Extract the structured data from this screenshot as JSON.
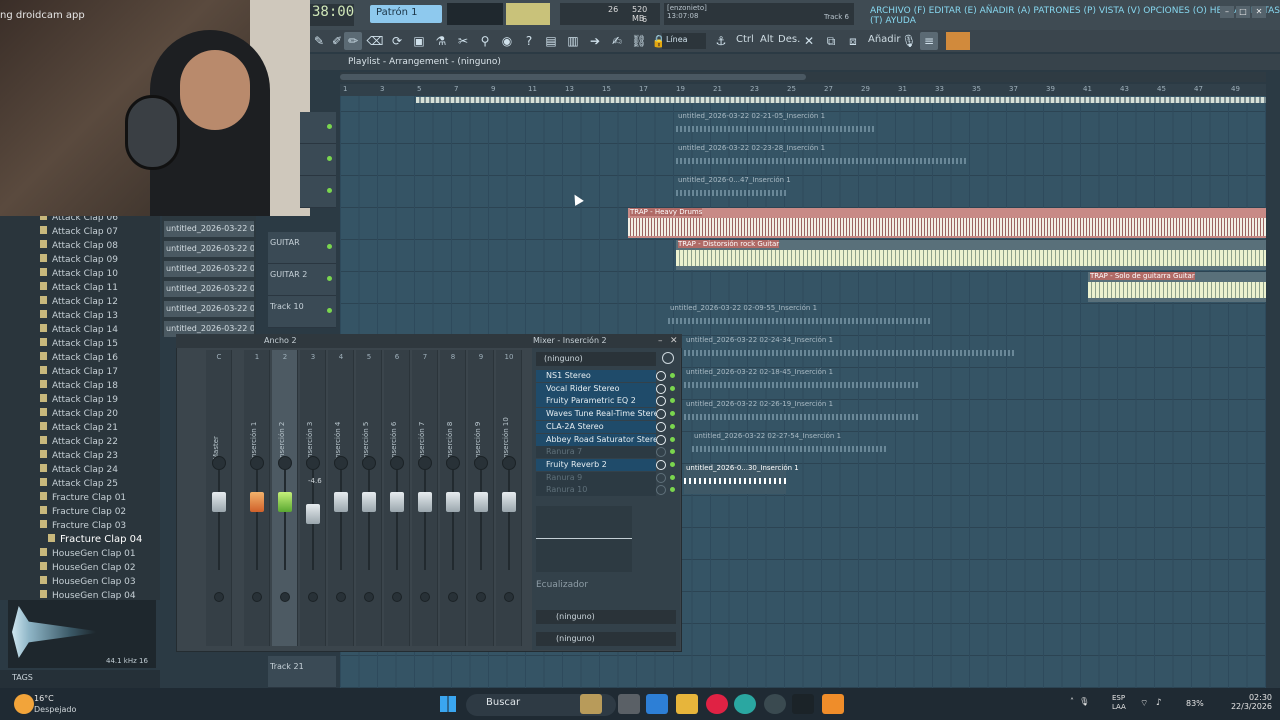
{
  "webcam": {
    "title": "ng droidcam app"
  },
  "topbar": {
    "clock": "38:00",
    "pattern": "Patrón 1",
    "cpu_num": "26",
    "memory": "520 MB",
    "polyphony": "6",
    "hint_title": "[enzonieto]",
    "hint_time": "13:07:08",
    "hint_track": "Track 6",
    "menu": "ARCHIVO (F) EDITAR (E) AÑADIR (A) PATRONES (P) VISTA (V) OPCIONES (O) HERRAMIENTAS (T) AYUDA"
  },
  "toolbar": {
    "line_mode": "Línea",
    "ctrl": "Ctrl",
    "alt": "Alt",
    "des": "Des.",
    "add": "Añadir"
  },
  "playlist": {
    "title": "Playlist - Arrangement - (ninguno)",
    "ruler": [
      "1",
      "3",
      "5",
      "7",
      "9",
      "11",
      "13",
      "15",
      "17",
      "19",
      "21",
      "23",
      "25",
      "27",
      "29",
      "31",
      "33",
      "35",
      "37",
      "39",
      "41",
      "43",
      "45",
      "47",
      "49"
    ],
    "tracks": [
      {
        "name": ""
      },
      {
        "name": ""
      },
      {
        "name": ""
      },
      {
        "name": "GUITAR"
      },
      {
        "name": "GUITAR 2"
      },
      {
        "name": "Track 10"
      }
    ],
    "bottom_track": "Track 21",
    "clips": [
      "untitled_2026-03-22 02-21-05_Inserción 1",
      "untitled_2026-03-22 02-23-28_Inserción 1",
      "untitled_2026-0...47_Inserción 1",
      "TRAP - Heavy Drums",
      "TRAP - Distorsión rock Guitar",
      "TRAP - Solo de guitarra Guitar",
      "untitled_2026-03-22 02-09-55_Inserción 1",
      "untitled_2026-03-22 02-24-34_Inserción 1",
      "untitled_2026-03-22 02-18-45_Inserción 1",
      "untitled_2026-03-22 02-26-19_Inserción 1",
      "untitled_2026-03-22 02-27-54_Inserción 1",
      "untitled_2026-0...30_Inserción 1"
    ]
  },
  "browser": {
    "items": [
      "Attack Clap 06",
      "Attack Clap 07",
      "Attack Clap 08",
      "Attack Clap 09",
      "Attack Clap 10",
      "Attack Clap 11",
      "Attack Clap 12",
      "Attack Clap 13",
      "Attack Clap 14",
      "Attack Clap 15",
      "Attack Clap 16",
      "Attack Clap 17",
      "Attack Clap 18",
      "Attack Clap 19",
      "Attack Clap 20",
      "Attack Clap 21",
      "Attack Clap 22",
      "Attack Clap 23",
      "Attack Clap 24",
      "Attack Clap 25",
      "Fracture Clap 01",
      "Fracture Clap 02",
      "Fracture Clap 03",
      "Fracture Clap 04",
      "HouseGen Clap 01",
      "HouseGen Clap 02",
      "HouseGen Clap 03",
      "HouseGen Clap 04"
    ],
    "selected": "Fracture Clap 04",
    "sample_rate": "44.1 kHz 16",
    "tags": "TAGS"
  },
  "picker": {
    "items": [
      "untitled_2026-03-22 02-...",
      "untitled_2026-03-22 02-...",
      "untitled_2026-03-22 02-...",
      "untitled_2026-03-22 02-...",
      "untitled_2026-03-22 02-...",
      "untitled_2026-03-22 02-..."
    ]
  },
  "mixer": {
    "width_label": "Ancho 2",
    "title": "Mixer - Inserción 2",
    "strips": [
      {
        "num": "C",
        "name": "Master"
      },
      {
        "num": "1",
        "name": "Inserción 1"
      },
      {
        "num": "2",
        "name": "Inserción 2"
      },
      {
        "num": "3",
        "name": "Inserción 3"
      },
      {
        "num": "4",
        "name": "Inserción 4"
      },
      {
        "num": "5",
        "name": "Inserción 5"
      },
      {
        "num": "6",
        "name": "Inserción 6"
      },
      {
        "num": "7",
        "name": "Inserción 7"
      },
      {
        "num": "8",
        "name": "Inserción 8"
      },
      {
        "num": "9",
        "name": "Inserción 9"
      },
      {
        "num": "10",
        "name": "Inserción 10"
      }
    ],
    "db_value": "-4.6",
    "preset": "(ninguno)",
    "slots": [
      "NS1 Stereo",
      "Vocal Rider Stereo",
      "Fruity Parametric EQ 2",
      "Waves Tune Real-Time Stereo",
      "CLA-2A Stereo",
      "Abbey Road Saturator Stereo",
      "Ranura 7",
      "Fruity Reverb 2",
      "Ranura 9",
      "Ranura 10"
    ],
    "eq_label": "Ecualizador",
    "in_route": "(ninguno)",
    "out_route": "(ninguno)"
  },
  "taskbar": {
    "temp": "16°C",
    "condition": "Despejado",
    "search": "Buscar",
    "lang1": "ESP",
    "lang2": "LAA",
    "battery": "83%",
    "time": "02:30",
    "date": "22/3/2026"
  }
}
